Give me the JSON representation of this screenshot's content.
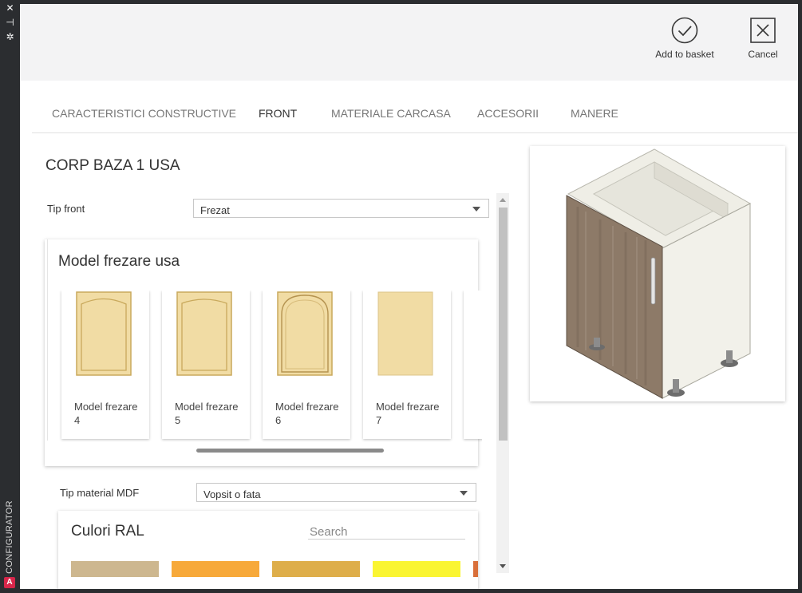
{
  "side_rail": {
    "close_glyph": "✕",
    "pin_glyph": "⊣",
    "settings_glyph": "✲",
    "vertical_label": "CONFIGURATOR",
    "logo_letter": "A"
  },
  "toolbar": {
    "add_label": "Add to basket",
    "cancel_label": "Cancel"
  },
  "tabs": [
    {
      "label": "CARACTERISTICI CONSTRUCTIVE",
      "active": false
    },
    {
      "label": "FRONT",
      "active": true
    },
    {
      "label": "MATERIALE CARCASA",
      "active": false
    },
    {
      "label": "ACCESORII",
      "active": false
    },
    {
      "label": "MANERE",
      "active": false
    }
  ],
  "item": {
    "title": "CORP BAZA 1 USA"
  },
  "front": {
    "label": "Tip front",
    "value": "Frezat"
  },
  "models": {
    "title": "Model frezare usa",
    "items": [
      {
        "label": "Model frezare 4",
        "icon": "arched-panel-door-icon"
      },
      {
        "label": "Model frezare 5",
        "icon": "arched-panel-door-icon"
      },
      {
        "label": "Model frezare 6",
        "icon": "arched-raised-panel-door-icon"
      },
      {
        "label": "Model frezare 7",
        "icon": "flat-door-icon"
      }
    ]
  },
  "mdf": {
    "label": "Tip material MDF",
    "value": "Vopsit o fata"
  },
  "ral": {
    "title": "Culori RAL",
    "search_placeholder": "Search",
    "swatches": [
      "#cdb78f",
      "#f7a93a",
      "#deae4a",
      "#faf532",
      "#d96f3a"
    ]
  },
  "colors": {
    "door_fill": "#f1dca4",
    "door_stroke": "#c9a95c",
    "cabinet_wood": "#8d7a68",
    "carcass": "#efeee6"
  }
}
